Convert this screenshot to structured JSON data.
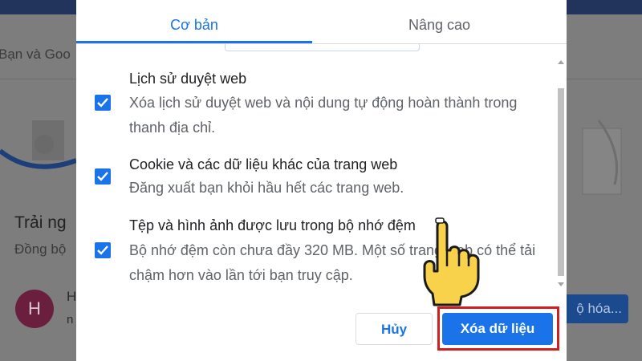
{
  "background": {
    "left_text": "Bạn và Goo",
    "section_title": "Trải ng",
    "section_sub": "Đồng bộ",
    "avatar_letter": "H",
    "account_name": "H",
    "account_sub": "n",
    "sync_button": "ộ hóa..."
  },
  "dialog": {
    "tabs": [
      {
        "label": "Cơ bản",
        "active": true
      },
      {
        "label": "Nâng cao",
        "active": false
      }
    ],
    "items": [
      {
        "checked": true,
        "title": "Lịch sử duyệt web",
        "desc": "Xóa lịch sử duyệt web và nội dung tự động hoàn thành trong thanh địa chỉ."
      },
      {
        "checked": true,
        "title": "Cookie và các dữ liệu khác của trang web",
        "desc": "Đăng xuất bạn khỏi hầu hết các trang web."
      },
      {
        "checked": true,
        "title": "Tệp và hình ảnh được lưu trong bộ nhớ đệm",
        "desc": "Bộ nhớ đệm còn chưa đầy 320 MB. Một số trang web có thể tải chậm hơn vào lần tới bạn truy cập."
      }
    ],
    "cancel_label": "Hủy",
    "clear_label": "Xóa dữ liệu"
  },
  "colors": {
    "accent": "#1a73e8",
    "highlight": "#d11f1f"
  },
  "icons": [
    "checkbox-checked-icon",
    "scroll-up-arrow-icon",
    "scroll-down-arrow-icon",
    "pointing-hand-icon"
  ]
}
